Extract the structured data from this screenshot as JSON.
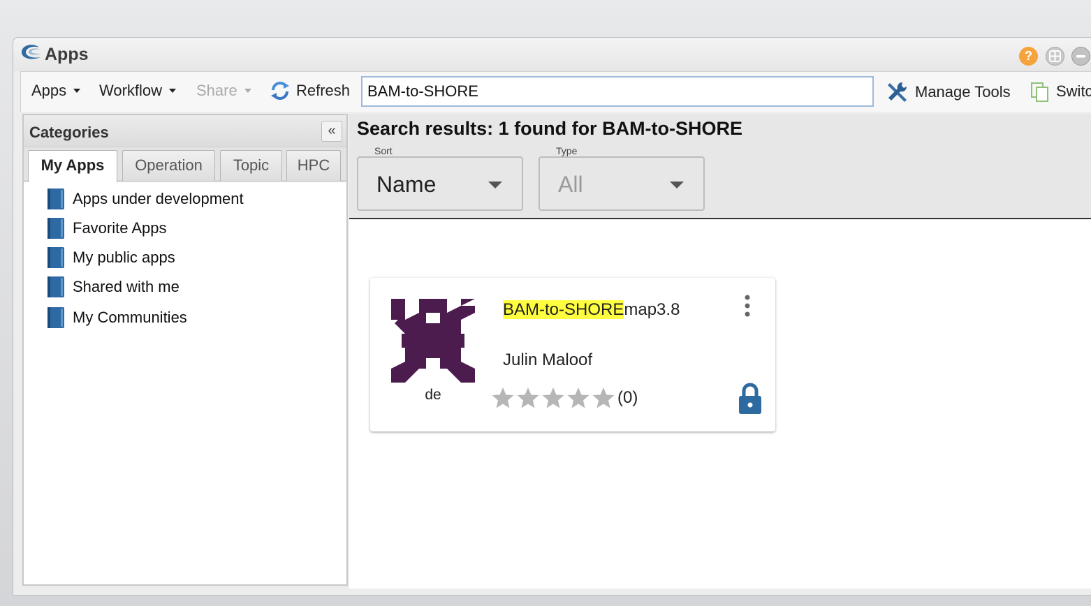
{
  "window": {
    "title": "Apps"
  },
  "toolbar": {
    "apps_label": "Apps",
    "workflow_label": "Workflow",
    "share_label": "Share",
    "refresh_label": "Refresh",
    "search_value": "BAM-to-SHORE",
    "manage_tools_label": "Manage Tools",
    "switch_label": "Switc"
  },
  "categories": {
    "title": "Categories",
    "tabs": [
      {
        "label": "My Apps",
        "active": true
      },
      {
        "label": "Operation",
        "active": false
      },
      {
        "label": "Topic",
        "active": false
      },
      {
        "label": "HPC",
        "active": false
      }
    ],
    "items": [
      {
        "label": "Apps under development"
      },
      {
        "label": "Favorite Apps"
      },
      {
        "label": "My public apps"
      },
      {
        "label": "Shared with me"
      },
      {
        "label": "My Communities"
      }
    ]
  },
  "results": {
    "title": "Search results: 1 found for BAM-to-SHORE",
    "sort": {
      "label": "Sort",
      "value": "Name"
    },
    "type": {
      "label": "Type",
      "value": "All"
    }
  },
  "app_card": {
    "name_highlight": "BAM-to-SHORE",
    "name_rest": "map3.8",
    "icon_label": "de",
    "author": "Julin Maloof",
    "rating_stars": 0,
    "rating_count": "(0)",
    "icon_color": "#4b1c4d"
  },
  "colors": {
    "accent": "#2c6aa0",
    "highlight": "#ffff3f"
  }
}
